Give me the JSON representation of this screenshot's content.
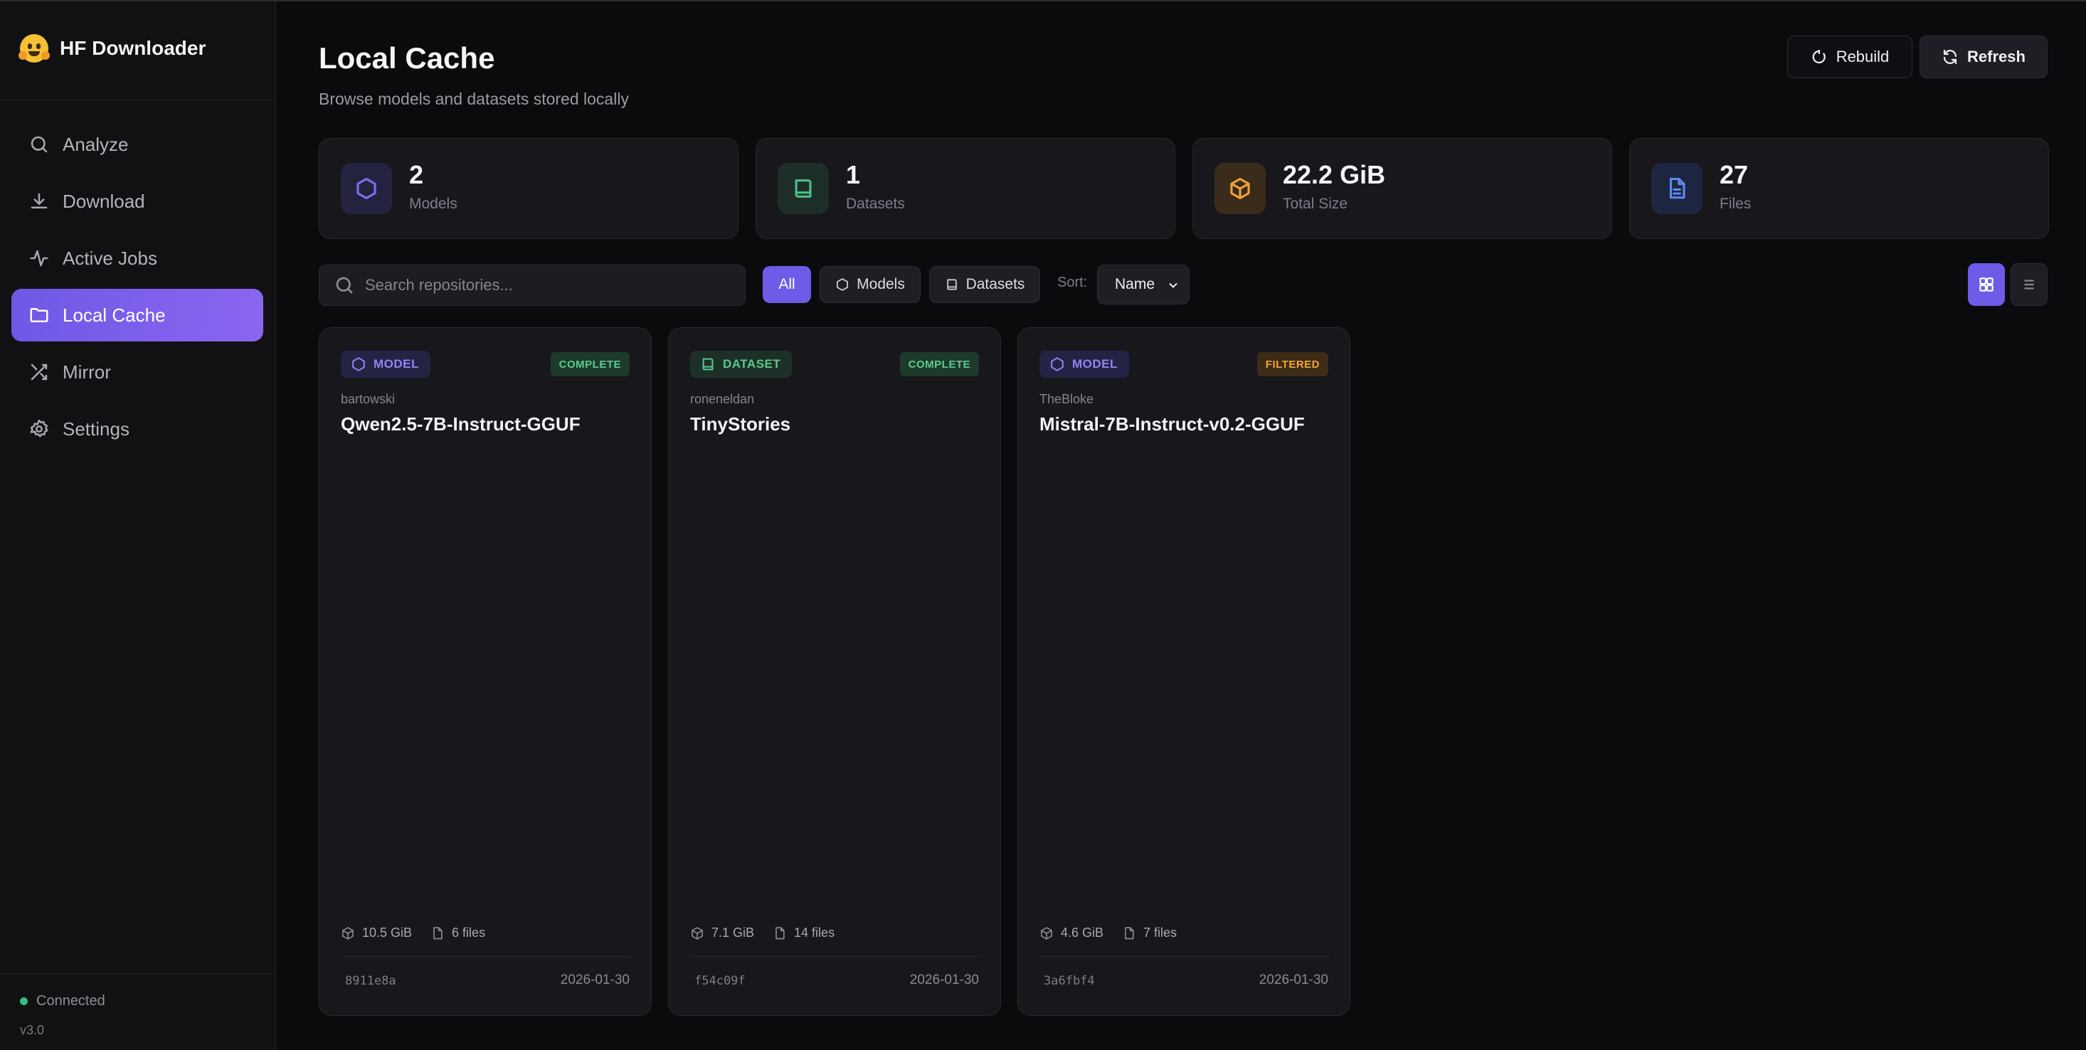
{
  "app": {
    "title": "HF Downloader",
    "status": "Connected",
    "version": "v3.0"
  },
  "sidebar": {
    "items": [
      {
        "label": "Analyze",
        "icon": "search-icon",
        "active": false
      },
      {
        "label": "Download",
        "icon": "download-icon",
        "active": false
      },
      {
        "label": "Active Jobs",
        "icon": "activity-icon",
        "active": false
      },
      {
        "label": "Local Cache",
        "icon": "folder-icon",
        "active": true
      },
      {
        "label": "Mirror",
        "icon": "shuffle-icon",
        "active": false
      },
      {
        "label": "Settings",
        "icon": "gear-icon",
        "active": false
      }
    ]
  },
  "header": {
    "title": "Local Cache",
    "subtitle": "Browse models and datasets stored locally",
    "rebuild_label": "Rebuild",
    "refresh_label": "Refresh"
  },
  "stats": [
    {
      "value": "2",
      "label": "Models",
      "icon": "hexagon-icon",
      "color": "#7b6ff0"
    },
    {
      "value": "1",
      "label": "Datasets",
      "icon": "book-icon",
      "color": "#4cbf86"
    },
    {
      "value": "22.2 GiB",
      "label": "Total Size",
      "icon": "box-icon",
      "color": "#f0a33a"
    },
    {
      "value": "27",
      "label": "Files",
      "icon": "file-icon",
      "color": "#5b8cf0"
    }
  ],
  "filters": {
    "search_placeholder": "Search repositories...",
    "chips": [
      "All",
      "Models",
      "Datasets"
    ],
    "active_chip": "All",
    "sort_label": "Sort:",
    "sort_value": "Name",
    "view_mode": "grid"
  },
  "cards": [
    {
      "type": "MODEL",
      "status": "COMPLETE",
      "owner": "bartowski",
      "name": "Qwen2.5-7B-Instruct-GGUF",
      "size": "10.5 GiB",
      "files": "6 files",
      "hash": "8911e8a",
      "date": "2026-01-30"
    },
    {
      "type": "DATASET",
      "status": "COMPLETE",
      "owner": "roneneldan",
      "name": "TinyStories",
      "size": "7.1 GiB",
      "files": "14 files",
      "hash": "f54c09f",
      "date": "2026-01-30"
    },
    {
      "type": "MODEL",
      "status": "FILTERED",
      "owner": "TheBloke",
      "name": "Mistral-7B-Instruct-v0.2-GGUF",
      "size": "4.6 GiB",
      "files": "7 files",
      "hash": "3a6fbf4",
      "date": "2026-01-30"
    }
  ],
  "colors": {
    "accent": "#6c5ce7",
    "complete": "#5ccc8e",
    "filtered": "#f0a33a"
  }
}
